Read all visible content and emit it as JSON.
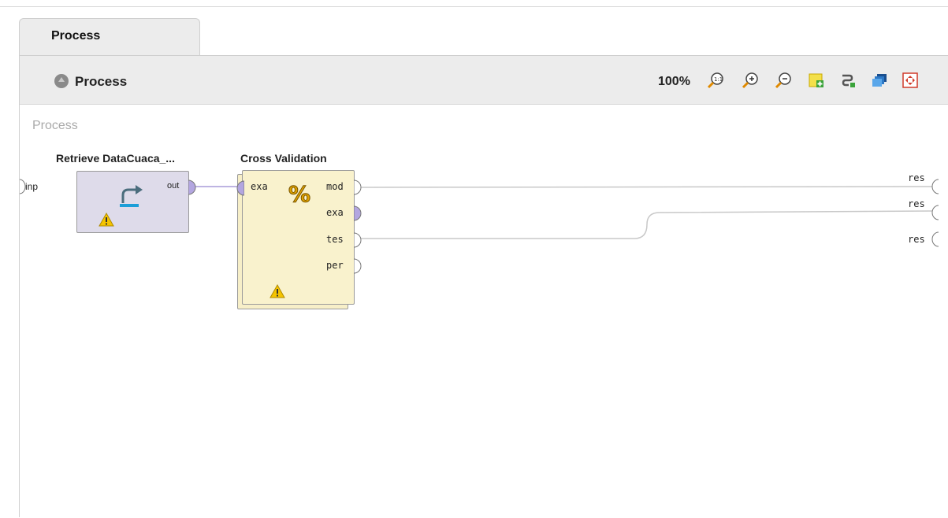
{
  "tab": {
    "label": "Process"
  },
  "toolbar": {
    "breadcrumb": "Process",
    "zoom": "100%"
  },
  "canvas": {
    "label": "Process",
    "input_port": "inp",
    "output_ports": [
      "res",
      "res",
      "res"
    ]
  },
  "operators": {
    "retrieve": {
      "title": "Retrieve DataCuaca_...",
      "out": "out",
      "icon": "retrieve-arrow-icon",
      "warning": true
    },
    "xval": {
      "title": "Cross Validation",
      "in": "exa",
      "outs": [
        "mod",
        "exa",
        "tes",
        "per"
      ],
      "icon": "percent-icon",
      "warning": true
    }
  },
  "colors": {
    "port_connected": "#b3a6e0",
    "retrieve_bg": "#dedbea",
    "xval_bg": "#f9f2cd",
    "warning": "#f5c400"
  }
}
